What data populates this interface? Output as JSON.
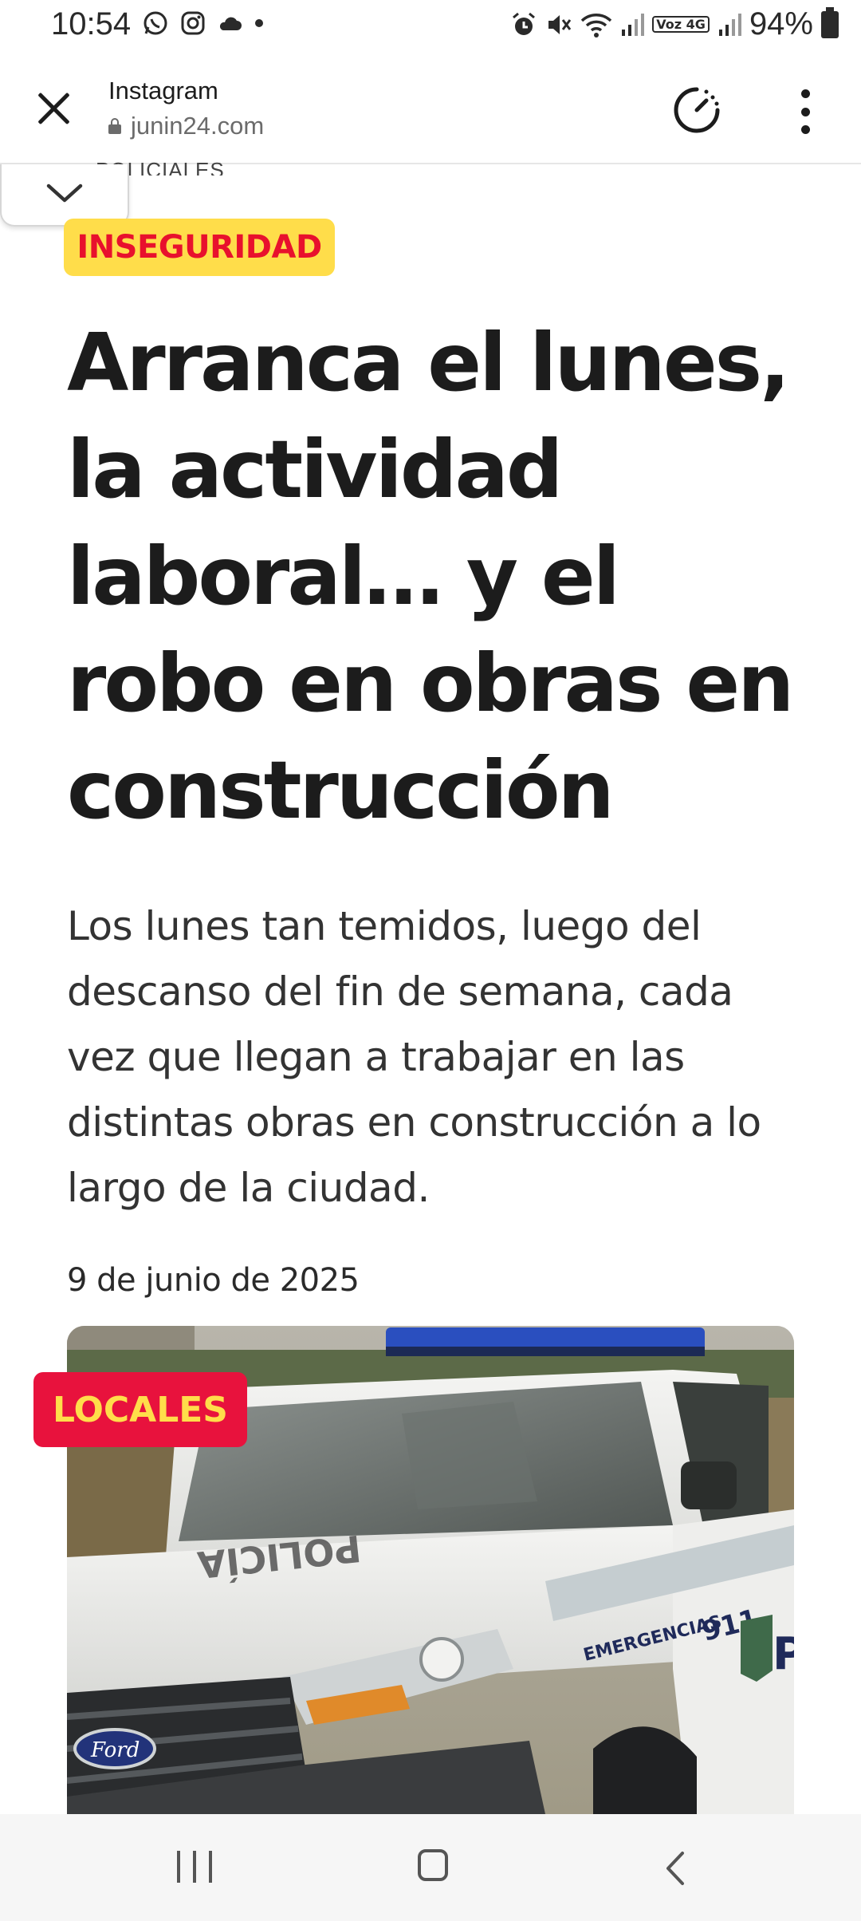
{
  "status_bar": {
    "time": "10:54",
    "battery": "94%",
    "left_icons": [
      "whatsapp-icon",
      "instagram-icon",
      "cloud-icon",
      "dot-icon"
    ],
    "right_icons": [
      "alarm-icon",
      "mute-icon",
      "wifi-icon",
      "signal-icon",
      "volte-icon",
      "signal-icon",
      "battery-icon"
    ],
    "volte_label": "Voz 4G"
  },
  "custom_tab": {
    "title": "Instagram",
    "url": "junin24.com"
  },
  "article": {
    "section_peek": "POLICIALES",
    "tag": "INSEGURIDAD",
    "headline": "Arranca el lunes, la actividad laboral… y el robo en obras en construcción",
    "lead": "Los lunes tan temidos, luego del descanso del fin de semana, cada vez que llegan a trabajar en las distintas obras en construcción a lo largo de la ciudad.",
    "date": "9 de junio de 2025",
    "image_tag": "LOCALES",
    "image_text": {
      "door_text": "POLI",
      "hood_text": "POLICÍA",
      "emergency_text": "EMERGENCIAS 911",
      "brand": "Ford"
    }
  },
  "colors": {
    "tag_yellow": "#ffdd4a",
    "tag_red": "#e8112d",
    "headline": "#1c1c1c",
    "body_text": "#333333"
  }
}
